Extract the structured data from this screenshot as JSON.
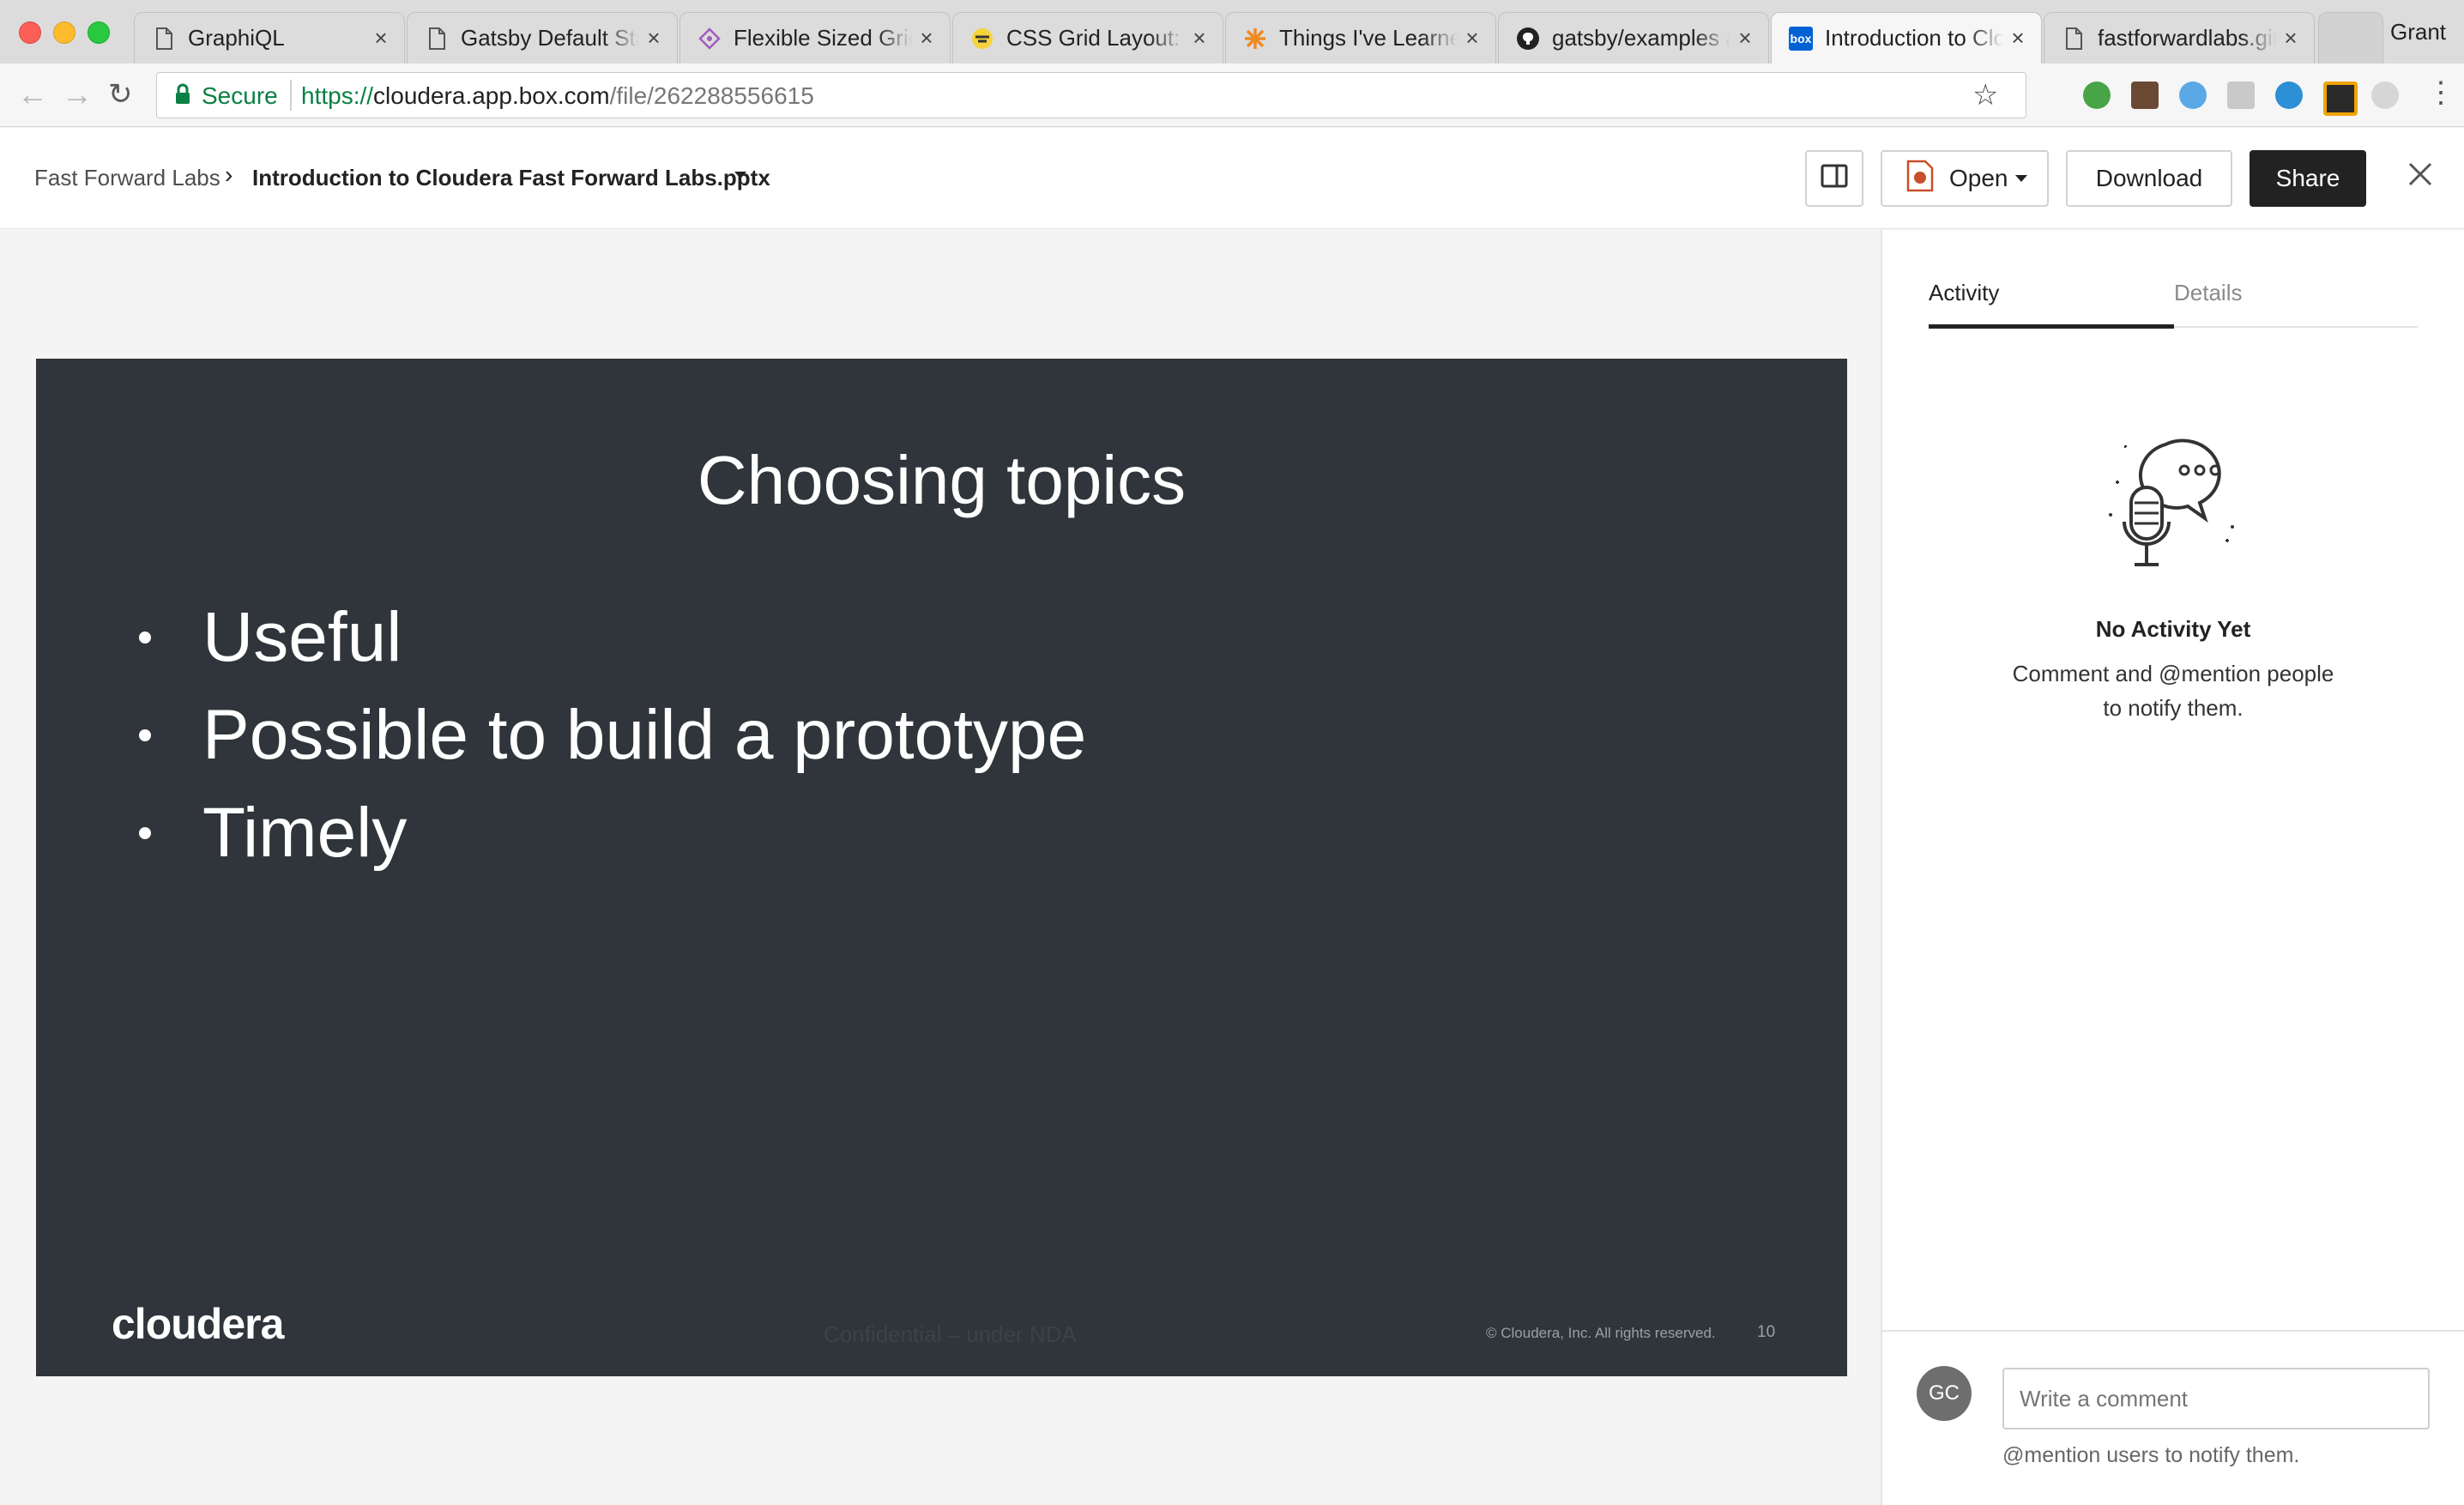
{
  "browser": {
    "tabs": [
      {
        "label": "GraphiQL",
        "icon": "doc-icon",
        "active": false
      },
      {
        "label": "Gatsby Default Sta",
        "icon": "doc-icon",
        "active": false
      },
      {
        "label": "Flexible Sized Grid",
        "icon": "diamond-icon",
        "active": false
      },
      {
        "label": "CSS Grid Layout: T",
        "icon": "css-tricks-icon",
        "active": false
      },
      {
        "label": "Things I've Learne",
        "icon": "asterisk-icon",
        "active": false
      },
      {
        "label": "gatsby/examples a",
        "icon": "github-icon",
        "active": false
      },
      {
        "label": "Introduction to Clo",
        "icon": "box-icon",
        "active": true
      },
      {
        "label": "fastforwardlabs.git",
        "icon": "doc-icon",
        "active": false
      }
    ],
    "profile_name": "Grant",
    "secure_label": "Secure",
    "url_scheme": "https://",
    "url_host": "cloudera.app.box.com",
    "url_path": "/file/262288556615",
    "box_favicon_text": "box"
  },
  "header": {
    "breadcrumb_parent": "Fast Forward Labs",
    "file_name": "Introduction to Cloudera Fast Forward Labs.pptx",
    "open_label": "Open",
    "download_label": "Download",
    "share_label": "Share"
  },
  "slide": {
    "title": "Choosing topics",
    "bullets": [
      "Useful",
      "Possible to build a prototype",
      "Timely"
    ],
    "logo": "cloudera",
    "confidential": "Confidential – under NDA",
    "copyright": "© Cloudera, Inc. All rights reserved.",
    "page_number": "10"
  },
  "sidebar": {
    "tabs": [
      {
        "label": "Activity",
        "active": true
      },
      {
        "label": "Details",
        "active": false
      }
    ],
    "empty_title": "No Activity Yet",
    "empty_line1": "Comment and @mention people",
    "empty_line2": "to notify them.",
    "avatar_initials": "GC",
    "comment_placeholder": "Write a comment",
    "mention_hint": "@mention users to notify them."
  },
  "colors": {
    "slide_bg": "#2f353a",
    "share_bg": "#222222",
    "secure_green": "#0b8043",
    "avatar_bg": "#6e6e6e"
  }
}
